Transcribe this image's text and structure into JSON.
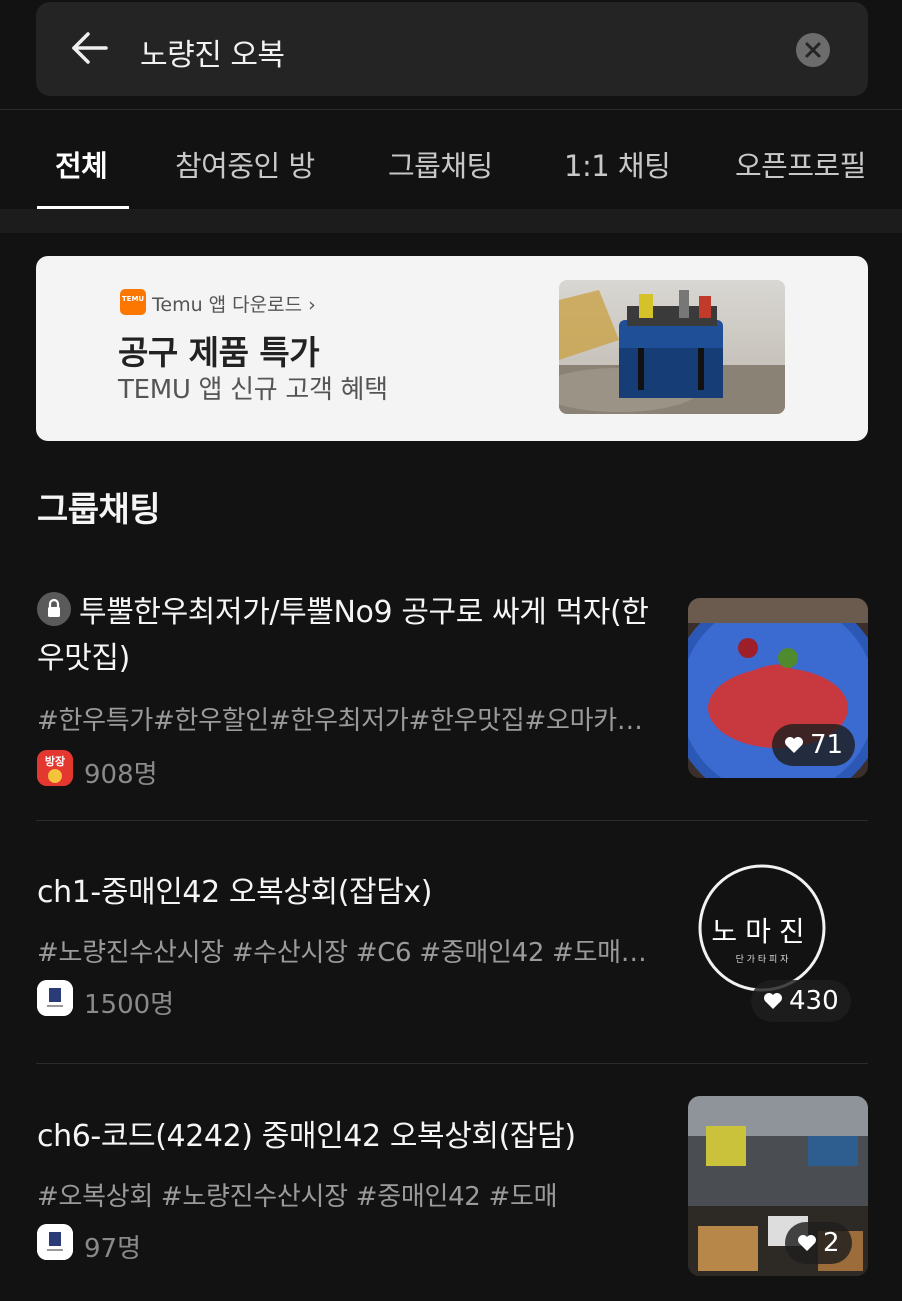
{
  "search": {
    "query": "노량진 오복"
  },
  "tabs": [
    {
      "label": "전체",
      "active": true
    },
    {
      "label": "참여중인 방"
    },
    {
      "label": "그룹채팅"
    },
    {
      "label": "1:1 채팅"
    },
    {
      "label": "오픈프로필"
    }
  ],
  "ad": {
    "logo_text": "TEMU",
    "brand_line": "Temu 앱 다운로드 ›",
    "title": "공구 제품 특가",
    "subtitle": "TEMU 앱 신규 고객 혜택"
  },
  "section": {
    "title": "그룹채팅"
  },
  "results": [
    {
      "title": "투뿔한우최저가/투뿔No9 공구로 싸게 먹자(한우맛집)",
      "locked": true,
      "tags": "#한우특가#한우할인#한우최저가#한우맛집#오마카…",
      "owner_badge": "방장",
      "members": "908명",
      "likes": "71"
    },
    {
      "title": "ch1-중매인42 오복상회(잡담x)",
      "locked": false,
      "tags": "#노량진수산시장 #수산시장 #C6 #중매인42 #도매…",
      "members": "1500명",
      "likes": "430",
      "thumb_text": "노마진",
      "thumb_subtext": "단 가 타 피 자"
    },
    {
      "title": "ch6-코드(4242) 중매인42 오복상회(잡담)",
      "locked": false,
      "tags": "#오복상회 #노량진수산시장 #중매인42 #도매",
      "members": "97명",
      "likes": "2"
    }
  ],
  "colors": {
    "background": "#121212",
    "ad_bg": "#f4f4f4",
    "temu_orange": "#fb7701"
  }
}
